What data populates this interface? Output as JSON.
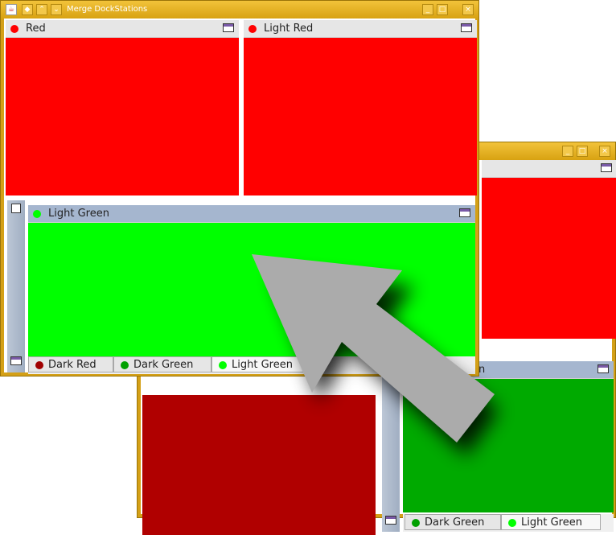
{
  "back_window": {
    "title": "",
    "panels": {
      "top": {
        "color": "#ff0000"
      },
      "bottom_left": {
        "color": "#b00000"
      },
      "dark_green": {
        "label_partial": "en",
        "color": "#00aa00"
      }
    },
    "tabs": [
      {
        "label": "Dark Green",
        "dot": "#00a000"
      },
      {
        "label": "Light Green",
        "dot": "#00ff00"
      }
    ]
  },
  "front_window": {
    "title": "Merge DockStations",
    "panels": {
      "red": {
        "label": "Red",
        "dot": "#ff0000",
        "color": "#ff0000"
      },
      "light_red": {
        "label": "Light Red",
        "dot": "#ff0000",
        "color": "#ff0000"
      },
      "light_green": {
        "label": "Light Green",
        "dot": "#00ff00",
        "color": "#00ff00"
      }
    },
    "tabs": [
      {
        "label": "Dark Red",
        "dot": "#a00000"
      },
      {
        "label": "Dark Green",
        "dot": "#00a000"
      },
      {
        "label": "Light Green",
        "dot": "#00ff00"
      }
    ]
  },
  "overlay": {
    "arrow": "merge-arrow"
  }
}
